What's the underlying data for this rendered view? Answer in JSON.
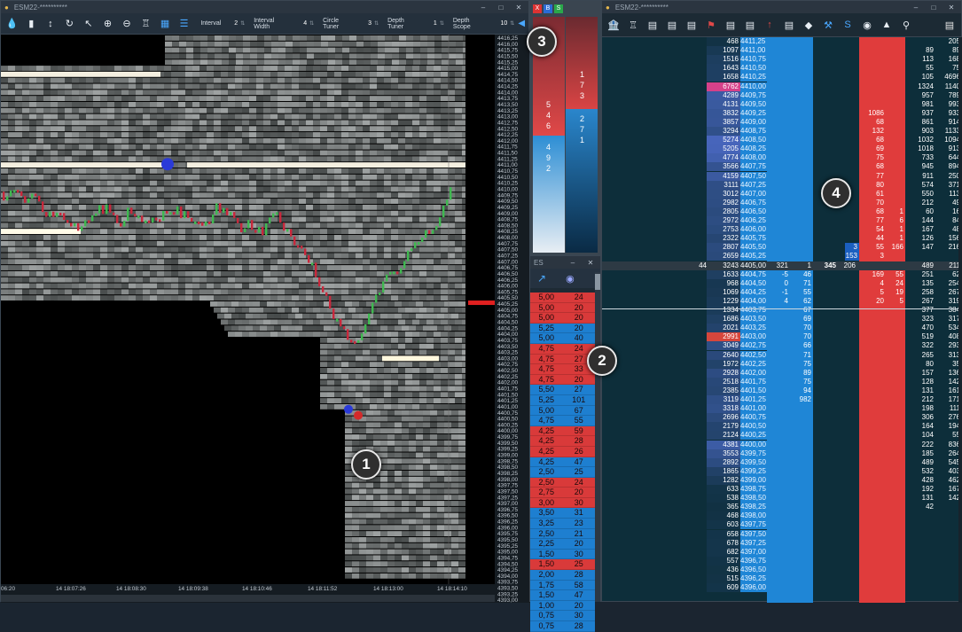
{
  "chart_window": {
    "title": "ESM22-**********",
    "toolbar": {
      "icons": [
        "drop-icon",
        "histogram-icon",
        "arrows-vertical-icon",
        "refresh-icon",
        "cursor-icon",
        "zoom-in-icon",
        "zoom-out-icon",
        "tooth-icon",
        "grid-icon",
        "layers-icon"
      ],
      "controls": [
        {
          "label": "Interval",
          "value": "2"
        },
        {
          "label": "Interval Width",
          "value": "4"
        },
        {
          "label": "Circle Tuner",
          "value": "3"
        },
        {
          "label": "Depth Tuner",
          "value": "1"
        },
        {
          "label": "Depth Scope",
          "value": "10"
        }
      ]
    },
    "price_axis": [
      "4416,25",
      "4416,00",
      "4415,75",
      "4415,50",
      "4415,25",
      "4415,00",
      "4414,75",
      "4414,50",
      "4414,25",
      "4414,00",
      "4413,75",
      "4413,50",
      "4413,25",
      "4413,00",
      "4412,75",
      "4412,50",
      "4412,25",
      "4412,00",
      "4411,75",
      "4411,50",
      "4411,25",
      "4411,00",
      "4410,75",
      "4410,50",
      "4410,25",
      "4410,00",
      "4409,75",
      "4409,50",
      "4409,25",
      "4409,00",
      "4408,75",
      "4408,50",
      "4408,25",
      "4408,00",
      "4407,75",
      "4407,50",
      "4407,25",
      "4407,00",
      "4406,75",
      "4406,50",
      "4406,25",
      "4406,00",
      "4405,75",
      "4405,50",
      "4405,25",
      "4405,00",
      "4404,75",
      "4404,50",
      "4404,25",
      "4404,00",
      "4403,75",
      "4403,50",
      "4403,25",
      "4403,00",
      "4402,75",
      "4402,50",
      "4402,25",
      "4402,00",
      "4401,75",
      "4401,50",
      "4401,25",
      "4401,00",
      "4400,75",
      "4400,50",
      "4400,25",
      "4400,00",
      "4399,75",
      "4399,50",
      "4399,25",
      "4399,00",
      "4398,75",
      "4398,50",
      "4398,25",
      "4398,00",
      "4397,75",
      "4397,50",
      "4397,25",
      "4397,00",
      "4396,75",
      "4396,50",
      "4396,25",
      "4396,00",
      "4395,75",
      "4395,50",
      "4395,25",
      "4395,00",
      "4394,75",
      "4394,50",
      "4394,25",
      "4394,00",
      "4393,75",
      "4393,50",
      "4393,25",
      "4393,00"
    ],
    "time_axis": [
      "06:20",
      "14 18:07:26",
      "14 18:08:30",
      "14 18:09:38",
      "14 18:10:46",
      "14 18:11:52",
      "14 18:13:00",
      "14 18:14:10"
    ]
  },
  "mini_dom": {
    "buttons": [
      "X",
      "B",
      "S"
    ],
    "sell_digits": [
      "5",
      "4",
      "6"
    ],
    "buy_digits": [
      "4",
      "9",
      "2"
    ],
    "sell_digits2": [
      "1",
      "7",
      "3"
    ],
    "buy_digits2": [
      "2",
      "7",
      "1"
    ]
  },
  "time_sales": {
    "title": "ES",
    "rows": [
      {
        "p": "5,00",
        "q": "24",
        "side": "sell"
      },
      {
        "p": "5,00",
        "q": "20",
        "side": "sell"
      },
      {
        "p": "5,00",
        "q": "20",
        "side": "sell"
      },
      {
        "p": "5,25",
        "q": "20",
        "side": "buy"
      },
      {
        "p": "5,00",
        "q": "40",
        "side": "buy"
      },
      {
        "p": "4,75",
        "q": "24",
        "side": "sell"
      },
      {
        "p": "4,75",
        "q": "27",
        "side": "sell"
      },
      {
        "p": "4,75",
        "q": "33",
        "side": "sell"
      },
      {
        "p": "4,75",
        "q": "20",
        "side": "sell"
      },
      {
        "p": "5,50",
        "q": "27",
        "side": "buy"
      },
      {
        "p": "5,25",
        "q": "101",
        "side": "buy"
      },
      {
        "p": "5,00",
        "q": "67",
        "side": "buy"
      },
      {
        "p": "4,75",
        "q": "55",
        "side": "buy"
      },
      {
        "p": "4,25",
        "q": "59",
        "side": "sell"
      },
      {
        "p": "4,25",
        "q": "28",
        "side": "sell"
      },
      {
        "p": "4,25",
        "q": "26",
        "side": "sell"
      },
      {
        "p": "4,25",
        "q": "47",
        "side": "buy"
      },
      {
        "p": "2,50",
        "q": "25",
        "side": "buy"
      },
      {
        "p": "2,50",
        "q": "24",
        "side": "sell"
      },
      {
        "p": "2,75",
        "q": "20",
        "side": "sell"
      },
      {
        "p": "3,00",
        "q": "30",
        "side": "sell"
      },
      {
        "p": "3,50",
        "q": "31",
        "side": "buy"
      },
      {
        "p": "3,25",
        "q": "23",
        "side": "buy"
      },
      {
        "p": "2,50",
        "q": "21",
        "side": "buy"
      },
      {
        "p": "2,25",
        "q": "20",
        "side": "buy"
      },
      {
        "p": "1,50",
        "q": "30",
        "side": "buy"
      },
      {
        "p": "1,50",
        "q": "25",
        "side": "sell"
      },
      {
        "p": "2,00",
        "q": "28",
        "side": "buy"
      },
      {
        "p": "1,75",
        "q": "58",
        "side": "buy"
      },
      {
        "p": "1,50",
        "q": "47",
        "side": "buy"
      },
      {
        "p": "1,00",
        "q": "20",
        "side": "buy"
      },
      {
        "p": "0,75",
        "q": "30",
        "side": "buy"
      },
      {
        "p": "0,75",
        "q": "28",
        "side": "buy"
      }
    ]
  },
  "ladder": {
    "title": "ESM22-**********",
    "toolbar_icons": [
      "bank-icon",
      "tooth-icon",
      "sheet-icon",
      "sheet-icon",
      "sheet-icon",
      "flag-icon",
      "sheet-icon",
      "sheet-icon",
      "rocket-icon",
      "sheet-icon",
      "bag-icon",
      "wrench-icon",
      "s-icon",
      "discord-icon",
      "chart-icon",
      "search-icon"
    ],
    "current_row": {
      "left": "44",
      "vol": "3243",
      "price": "4405,00",
      "bid": "321",
      "bsz": "1",
      "ask": "345",
      "asz": "206",
      "r1": "489",
      "r2": "211"
    },
    "rows": [
      {
        "v": "468",
        "p": "4411,25",
        "r1": "",
        "r2": "205"
      },
      {
        "v": "1097",
        "p": "4411,00",
        "r1": "89",
        "r2": "89"
      },
      {
        "v": "1516",
        "p": "4410,75",
        "r1": "113",
        "r2": "168"
      },
      {
        "v": "1643",
        "p": "4410,50",
        "r1": "55",
        "r2": "75"
      },
      {
        "v": "1658",
        "p": "4410,25",
        "r1": "105",
        "r2": "4696"
      },
      {
        "v": "6762",
        "p": "4410,00",
        "r1": "1324",
        "r2": "1140",
        "hl": "pink"
      },
      {
        "v": "4289",
        "p": "4409,75",
        "r1": "957",
        "r2": "789"
      },
      {
        "v": "4131",
        "p": "4409,50",
        "r1": "981",
        "r2": "993"
      },
      {
        "v": "3832",
        "p": "4409,25",
        "r1": "937",
        "r2": "933",
        "a": "1086"
      },
      {
        "v": "3857",
        "p": "4409,00",
        "r1": "861",
        "r2": "914",
        "a": "68"
      },
      {
        "v": "3294",
        "p": "4408,75",
        "r1": "903",
        "r2": "1133",
        "a": "132"
      },
      {
        "v": "5274",
        "p": "4408,50",
        "r1": "1032",
        "r2": "1094",
        "a": "68"
      },
      {
        "v": "5205",
        "p": "4408,25",
        "r1": "1018",
        "r2": "913",
        "a": "69"
      },
      {
        "v": "4774",
        "p": "4408,00",
        "r1": "733",
        "r2": "644",
        "a": "75"
      },
      {
        "v": "3566",
        "p": "4407,75",
        "r1": "945",
        "r2": "894",
        "a": "68"
      },
      {
        "v": "4159",
        "p": "4407,50",
        "r1": "911",
        "r2": "250",
        "a": "77"
      },
      {
        "v": "3111",
        "p": "4407,25",
        "r1": "574",
        "r2": "371",
        "a": "80"
      },
      {
        "v": "3012",
        "p": "4407,00",
        "r1": "550",
        "r2": "113",
        "a": "61"
      },
      {
        "v": "2982",
        "p": "4406,75",
        "r1": "212",
        "r2": "49",
        "a": "70"
      },
      {
        "v": "2805",
        "p": "4406,50",
        "r1": "60",
        "r2": "16",
        "a": "68",
        "b": "1"
      },
      {
        "v": "2972",
        "p": "4406,25",
        "r1": "144",
        "r2": "84",
        "a": "77",
        "b": "6"
      },
      {
        "v": "2753",
        "p": "4406,00",
        "r1": "167",
        "r2": "48",
        "a": "54",
        "b": "1"
      },
      {
        "v": "2322",
        "p": "4405,75",
        "r1": "126",
        "r2": "156",
        "a": "44",
        "b": "1"
      },
      {
        "v": "2807",
        "p": "4405,50",
        "r1": "147",
        "r2": "216",
        "a": "55",
        "b": "166",
        "c": "3"
      },
      {
        "v": "2659",
        "p": "4405,25",
        "r1": "",
        "r2": "",
        "a": "3",
        "c": "153"
      }
    ],
    "rows_below": [
      {
        "v": "1633",
        "p": "4404,75",
        "bid": "-5",
        "bsz": "46",
        "a": "169",
        "b": "55",
        "r1": "251",
        "r2": "62"
      },
      {
        "v": "968",
        "p": "4404,50",
        "bid": "0",
        "bsz": "71",
        "a": "4",
        "b": "24",
        "r1": "135",
        "r2": "254"
      },
      {
        "v": "1069",
        "p": "4404,25",
        "bid": "-1",
        "bsz": "55",
        "a": "5",
        "b": "19",
        "r1": "258",
        "r2": "267"
      },
      {
        "v": "1229",
        "p": "4404,00",
        "bid": "4",
        "bsz": "62",
        "a": "20",
        "b": "5",
        "r1": "267",
        "r2": "319"
      },
      {
        "v": "1334",
        "p": "4403,75",
        "bsz": "67",
        "r1": "377",
        "r2": "384"
      },
      {
        "v": "1686",
        "p": "4403,50",
        "bsz": "69",
        "r1": "323",
        "r2": "317"
      },
      {
        "v": "2021",
        "p": "4403,25",
        "bsz": "70",
        "r1": "470",
        "r2": "534"
      },
      {
        "v": "2991",
        "p": "4403,00",
        "bsz": "70",
        "r1": "519",
        "r2": "408",
        "hl": "red"
      },
      {
        "v": "3049",
        "p": "4402,75",
        "bsz": "66",
        "r1": "322",
        "r2": "293"
      },
      {
        "v": "2640",
        "p": "4402,50",
        "bsz": "71",
        "r1": "265",
        "r2": "313"
      },
      {
        "v": "1972",
        "p": "4402,25",
        "bsz": "75",
        "r1": "80",
        "r2": "35"
      },
      {
        "v": "2928",
        "p": "4402,00",
        "bsz": "89",
        "r1": "157",
        "r2": "136"
      },
      {
        "v": "2518",
        "p": "4401,75",
        "bsz": "75",
        "r1": "128",
        "r2": "142"
      },
      {
        "v": "2385",
        "p": "4401,50",
        "bsz": "94",
        "r1": "131",
        "r2": "161"
      },
      {
        "v": "3119",
        "p": "4401,25",
        "bsz": "982",
        "r1": "212",
        "r2": "171"
      },
      {
        "v": "3318",
        "p": "4401,00",
        "r1": "198",
        "r2": "111"
      },
      {
        "v": "2696",
        "p": "4400,75",
        "r1": "306",
        "r2": "276"
      },
      {
        "v": "2179",
        "p": "4400,50",
        "r1": "164",
        "r2": "194"
      },
      {
        "v": "2124",
        "p": "4400,25",
        "r1": "104",
        "r2": "55"
      },
      {
        "v": "4381",
        "p": "4400,00",
        "r1": "222",
        "r2": "836"
      },
      {
        "v": "3553",
        "p": "4399,75",
        "r1": "185",
        "r2": "264"
      },
      {
        "v": "2892",
        "p": "4399,50",
        "r1": "489",
        "r2": "545"
      },
      {
        "v": "1865",
        "p": "4399,25",
        "r1": "532",
        "r2": "403"
      },
      {
        "v": "1282",
        "p": "4399,00",
        "r1": "428",
        "r2": "462"
      },
      {
        "v": "633",
        "p": "4398,75",
        "r1": "192",
        "r2": "167"
      },
      {
        "v": "538",
        "p": "4398,50",
        "r1": "131",
        "r2": "142"
      },
      {
        "v": "365",
        "p": "4398,25",
        "r1": "42",
        "r2": ""
      },
      {
        "v": "468",
        "p": "4398,00"
      },
      {
        "v": "603",
        "p": "4397,75"
      },
      {
        "v": "658",
        "p": "4397,50"
      },
      {
        "v": "678",
        "p": "4397,25"
      },
      {
        "v": "682",
        "p": "4397,00"
      },
      {
        "v": "557",
        "p": "4396,75"
      },
      {
        "v": "436",
        "p": "4396,50"
      },
      {
        "v": "515",
        "p": "4396,25"
      },
      {
        "v": "609",
        "p": "4396,00"
      }
    ]
  },
  "badges": {
    "one": "1",
    "two": "2",
    "three": "3",
    "four": "4"
  },
  "colors": {
    "bid": "#1e7fd0",
    "ask": "#d93a3a",
    "up": "#3fb950",
    "down": "#c9283c",
    "bg": "#101820"
  }
}
